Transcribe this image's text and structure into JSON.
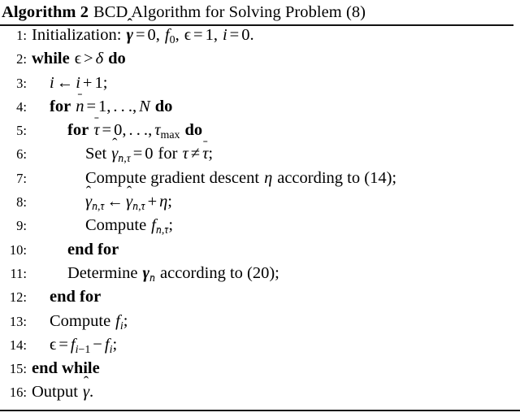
{
  "algorithm": {
    "label": "Algorithm 2",
    "caption": "BCD Algorithm for Solving Problem (8)",
    "steps": [
      {
        "num": "1:",
        "indent": 0,
        "text": "Initialization: γ̂ = 0, f₀, ϵ = 1, i = 0."
      },
      {
        "num": "2:",
        "indent": 0,
        "text": "while ϵ > δ do"
      },
      {
        "num": "3:",
        "indent": 1,
        "text": "i ← i + 1;"
      },
      {
        "num": "4:",
        "indent": 1,
        "text": "for n̄ = 1, . . . , N do"
      },
      {
        "num": "5:",
        "indent": 2,
        "text": "for τ̄ = 0, . . . , τmax do"
      },
      {
        "num": "6:",
        "indent": 3,
        "text": "Set γ̂n̄,τ = 0 for τ ≠ τ̄;"
      },
      {
        "num": "7:",
        "indent": 3,
        "text": "Compute gradient descent η according to (14);"
      },
      {
        "num": "8:",
        "indent": 3,
        "text": "γ̂n̄,τ̄ ← γ̂n̄,τ̄ + η;"
      },
      {
        "num": "9:",
        "indent": 3,
        "text": "Compute fn̄,τ̄;"
      },
      {
        "num": "10:",
        "indent": 2,
        "text": "end for"
      },
      {
        "num": "11:",
        "indent": 2,
        "text": "Determine γn̄ according to (20);"
      },
      {
        "num": "12:",
        "indent": 1,
        "text": "end for"
      },
      {
        "num": "13:",
        "indent": 1,
        "text": "Compute fᵢ;"
      },
      {
        "num": "14:",
        "indent": 1,
        "text": "ϵ = fᵢ₋₁ − fᵢ;"
      },
      {
        "num": "15:",
        "indent": 0,
        "text": "end while"
      },
      {
        "num": "16:",
        "indent": 0,
        "text": "Output γ̂."
      }
    ]
  },
  "colors": {
    "text": "#000000",
    "rule": "#111111",
    "background": "#ffffff"
  }
}
